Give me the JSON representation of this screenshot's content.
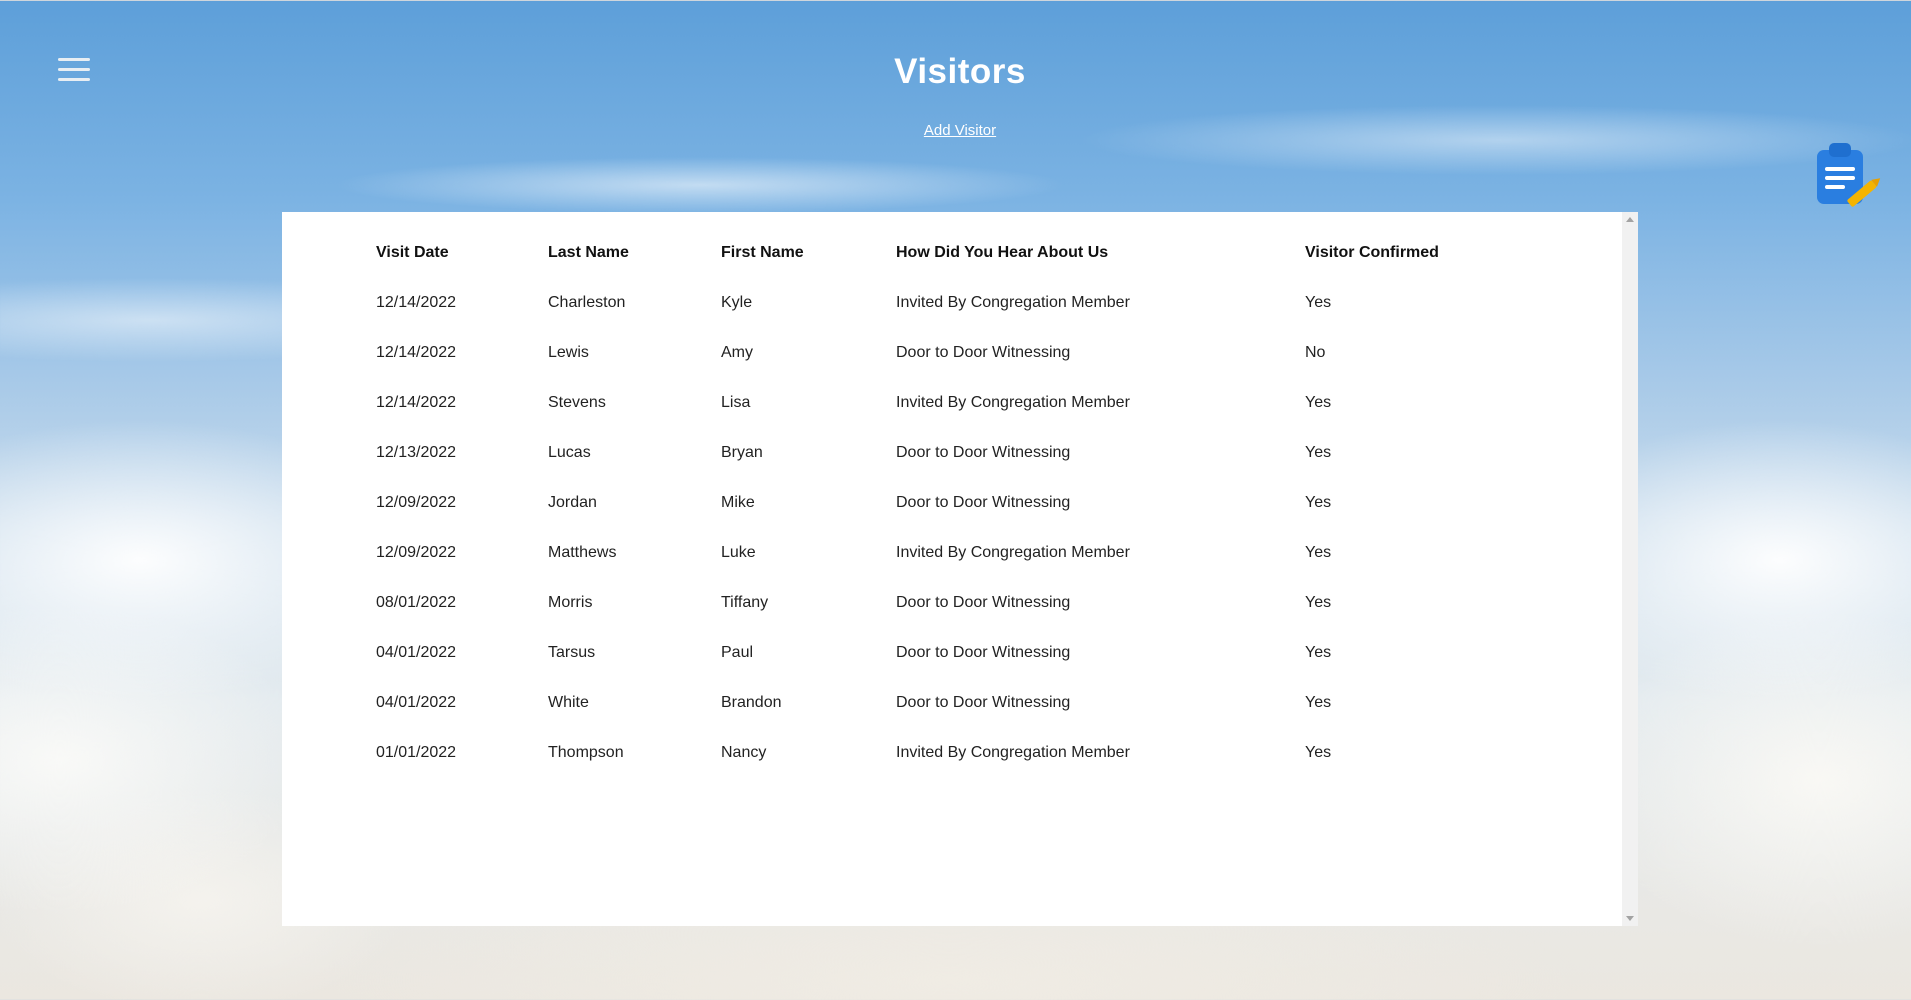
{
  "header": {
    "title": "Visitors",
    "add_link": "Add Visitor",
    "menu_icon": "hamburger-menu-icon",
    "clipboard_icon": "clipboard-edit-icon"
  },
  "table": {
    "columns": [
      "Visit Date",
      "Last Name",
      "First Name",
      "How Did You Hear About Us",
      "Visitor Confirmed"
    ],
    "rows": [
      [
        "12/14/2022",
        "Charleston",
        "Kyle",
        "Invited By Congregation Member",
        "Yes"
      ],
      [
        "12/14/2022",
        "Lewis",
        "Amy",
        "Door to Door Witnessing",
        "No"
      ],
      [
        "12/14/2022",
        "Stevens",
        "Lisa",
        "Invited By Congregation Member",
        "Yes"
      ],
      [
        "12/13/2022",
        "Lucas",
        "Bryan",
        "Door to Door Witnessing",
        "Yes"
      ],
      [
        "12/09/2022",
        "Jordan",
        "Mike",
        "Door to Door Witnessing",
        "Yes"
      ],
      [
        "12/09/2022",
        "Matthews",
        "Luke",
        "Invited By Congregation Member",
        "Yes"
      ],
      [
        "08/01/2022",
        "Morris",
        "Tiffany",
        "Door to Door Witnessing",
        "Yes"
      ],
      [
        "04/01/2022",
        "Tarsus",
        "Paul",
        "Door to Door Witnessing",
        "Yes"
      ],
      [
        "04/01/2022",
        "White",
        "Brandon",
        "Door to Door Witnessing",
        "Yes"
      ],
      [
        "01/01/2022",
        "Thompson",
        "Nancy",
        "Invited By Congregation Member",
        "Yes"
      ]
    ]
  },
  "colors": {
    "title": "#ffffff",
    "icon_blue": "#2a7ee0",
    "pencil_yellow": "#f4b400"
  }
}
